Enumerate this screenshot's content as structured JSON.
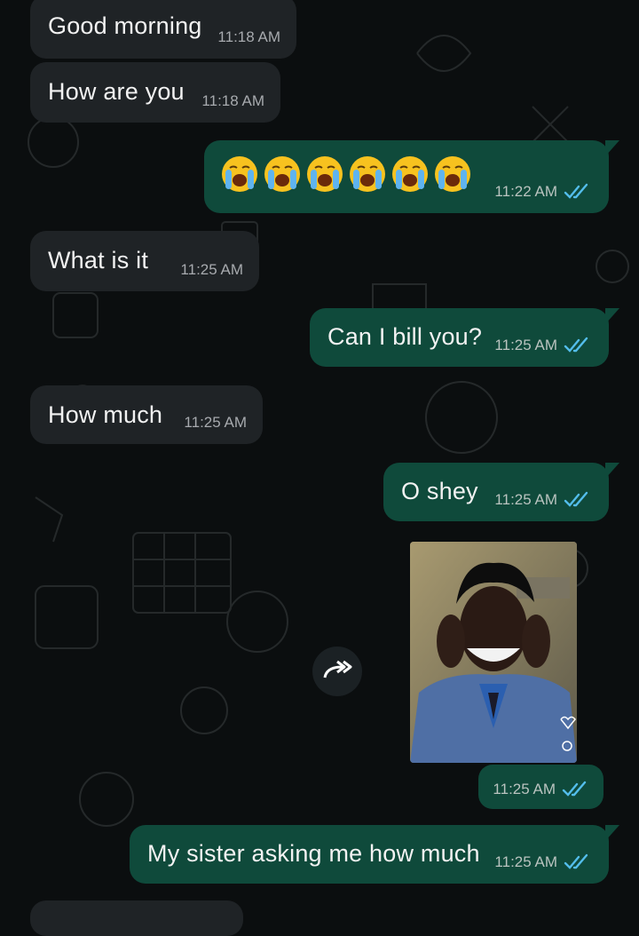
{
  "messages": [
    {
      "id": "m1",
      "dir": "in",
      "text": "Good morning",
      "time": "11:18 AM"
    },
    {
      "id": "m2",
      "dir": "in",
      "text": "How are you",
      "time": "11:18 AM"
    },
    {
      "id": "m3",
      "dir": "out",
      "emoji_count": 6,
      "emoji": "loudly-crying-face",
      "time": "11:22 AM",
      "status": "read"
    },
    {
      "id": "m4",
      "dir": "in",
      "text": "What is it",
      "time": "11:25 AM"
    },
    {
      "id": "m5",
      "dir": "out",
      "text": "Can I bill you?",
      "time": "11:25 AM",
      "status": "read"
    },
    {
      "id": "m6",
      "dir": "in",
      "text": "How much",
      "time": "11:25 AM"
    },
    {
      "id": "m7",
      "dir": "out",
      "text": "O shey",
      "time": "11:25 AM",
      "status": "read"
    },
    {
      "id": "m8",
      "dir": "out",
      "media": "photo",
      "time": "11:25 AM",
      "status": "read"
    },
    {
      "id": "m9",
      "dir": "out",
      "text": "My sister asking me how much",
      "time": "11:25 AM",
      "status": "read"
    }
  ],
  "colors": {
    "background": "#0b0e0f",
    "incoming_bubble": "#1f2326",
    "outgoing_bubble": "#0f4a3b",
    "read_ticks": "#53bdeb"
  }
}
